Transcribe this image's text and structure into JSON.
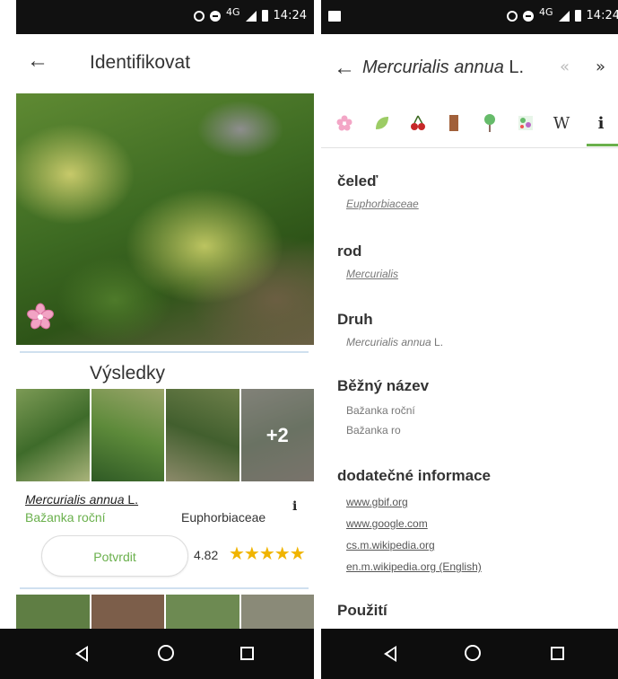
{
  "status": {
    "time": "14:24",
    "network": "4G"
  },
  "left": {
    "title": "Identifikovat",
    "results_title": "Výsledky",
    "more_count": "+2",
    "result": {
      "latin_name": "Mercurialis annua",
      "latin_author": " L.",
      "common_name": "Bažanka roční",
      "family": "Euphorbiaceae",
      "score": "4.82",
      "stars": "★★★★★",
      "info_glyph": "i",
      "confirm_label": "Potvrdit"
    }
  },
  "right": {
    "title_latin": "Mercurialis annua",
    "title_author": " L.",
    "prev_glyph": "«",
    "next_glyph": "»",
    "tabs": [
      {
        "icon": "flower-icon"
      },
      {
        "icon": "leaf-icon"
      },
      {
        "icon": "fruit-icon"
      },
      {
        "icon": "bark-icon"
      },
      {
        "icon": "tree-icon"
      },
      {
        "icon": "habitat-icon"
      },
      {
        "icon": "wikipedia-icon",
        "glyph": "W"
      },
      {
        "icon": "info-icon",
        "glyph": "i"
      }
    ],
    "family_label": "čeleď",
    "family_value": "Euphorbiaceae",
    "genus_label": "rod",
    "genus_value": "Mercurialis",
    "species_label": "Druh",
    "species_value": "Mercurialis annua",
    "species_author": " L.",
    "common_label": "Běžný název",
    "common_values": [
      "Bažanka roční",
      "Bažanka ro"
    ],
    "extra_label": "dodatečné informace",
    "links": [
      "www.gbif.org",
      "www.google.com",
      "cs.m.wikipedia.org",
      "en.m.wikipedia.org (English)"
    ],
    "usage_label": "Použití"
  }
}
